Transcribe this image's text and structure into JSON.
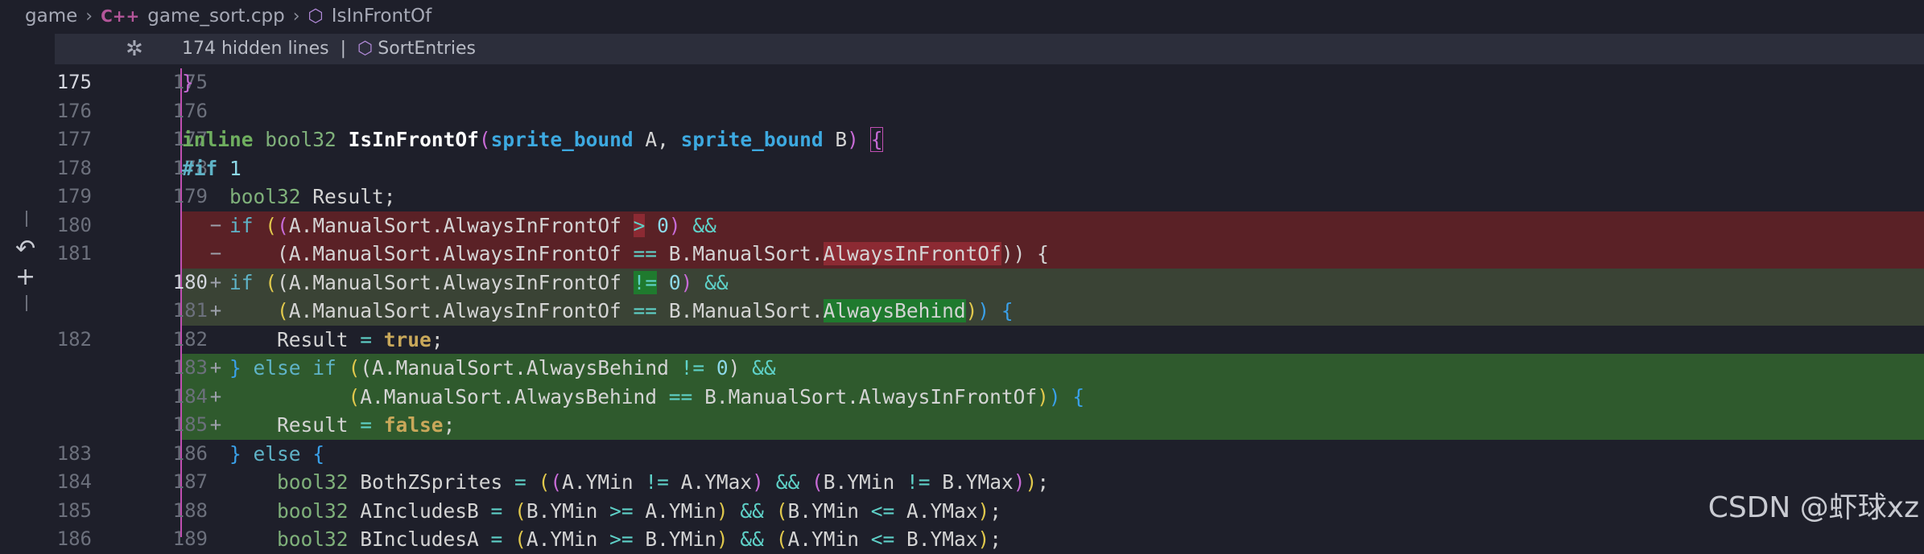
{
  "breadcrumb": {
    "root": "game",
    "file": "game_sort.cpp",
    "symbol": "IsInFrontOf"
  },
  "sticky": {
    "hidden_lines": "174 hidden lines",
    "separator": "|",
    "symbol": "SortEntries"
  },
  "lines": [
    {
      "old": "175",
      "new": "175",
      "marker": "",
      "type": "context",
      "text": "}"
    },
    {
      "old": "176",
      "new": "176",
      "marker": "",
      "type": "context",
      "text": ""
    },
    {
      "old": "177",
      "new": "177",
      "marker": "",
      "type": "context",
      "text": "inline bool32 IsInFrontOf(sprite_bound A, sprite_bound B) {"
    },
    {
      "old": "178",
      "new": "178",
      "marker": "",
      "type": "context",
      "text": "#if 1"
    },
    {
      "old": "179",
      "new": "179",
      "marker": "",
      "type": "context",
      "text": "    bool32 Result;"
    },
    {
      "old": "180",
      "new": "",
      "marker": "−",
      "type": "deleted",
      "text": "    if ((A.ManualSort.AlwaysInFrontOf > 0) &&"
    },
    {
      "old": "181",
      "new": "",
      "marker": "−",
      "type": "deleted",
      "text": "        (A.ManualSort.AlwaysInFrontOf == B.ManualSort.AlwaysInFrontOf)) {"
    },
    {
      "old": "",
      "new": "180",
      "marker": "+",
      "type": "added-modified",
      "text": "    if ((A.ManualSort.AlwaysInFrontOf != 0) &&"
    },
    {
      "old": "",
      "new": "181",
      "marker": "+",
      "type": "added-modified",
      "text": "        (A.ManualSort.AlwaysInFrontOf == B.ManualSort.AlwaysBehind)) {"
    },
    {
      "old": "182",
      "new": "182",
      "marker": "",
      "type": "context",
      "text": "        Result = true;"
    },
    {
      "old": "",
      "new": "183",
      "marker": "+",
      "type": "added",
      "text": "    } else if ((A.ManualSort.AlwaysBehind != 0) &&"
    },
    {
      "old": "",
      "new": "184",
      "marker": "+",
      "type": "added",
      "text": "              (A.ManualSort.AlwaysBehind == B.ManualSort.AlwaysInFrontOf)) {"
    },
    {
      "old": "",
      "new": "185",
      "marker": "+",
      "type": "added",
      "text": "        Result = false;"
    },
    {
      "old": "183",
      "new": "186",
      "marker": "",
      "type": "context",
      "text": "    } else {"
    },
    {
      "old": "184",
      "new": "187",
      "marker": "",
      "type": "context",
      "text": "        bool32 BothZSprites = ((A.YMin != A.YMax) && (B.YMin != B.YMax));"
    },
    {
      "old": "185",
      "new": "188",
      "marker": "",
      "type": "context",
      "text": "        bool32 AIncludesB = (B.YMin >= A.YMin) && (B.YMin <= A.YMax);"
    },
    {
      "old": "186",
      "new": "189",
      "marker": "",
      "type": "context",
      "text": "        bool32 BIncludesA = (A.YMin >= B.YMin) && (A.YMin <= B.YMax);"
    }
  ],
  "watermark": "CSDN @虾球xz",
  "icons": {
    "file_type": "cpp-icon",
    "symbol": "cube-icon",
    "unfold": "unfold-icon",
    "revert": "revert-icon",
    "stage": "plus-icon"
  },
  "colors": {
    "background": "#1e1f2a",
    "deleted": "#5a2126",
    "added": "#2f5a2d",
    "modified": "#3a4335",
    "accent": "#c04fb2"
  }
}
